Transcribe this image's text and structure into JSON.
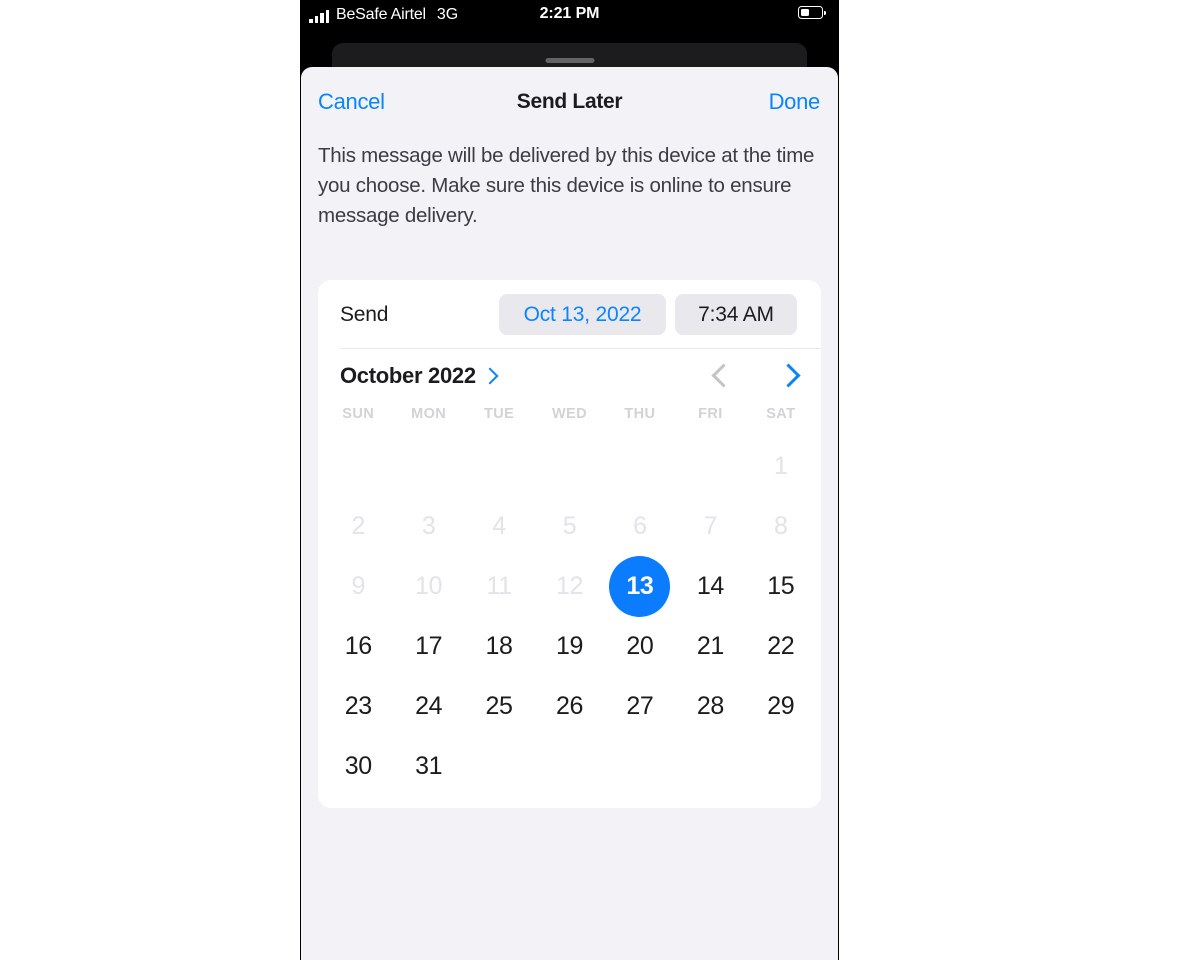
{
  "status_bar": {
    "signal_icon": "signal-bars-icon",
    "carrier": "BeSafe Airtel",
    "network": "3G",
    "time": "2:21 PM",
    "battery_icon": "battery-icon"
  },
  "navbar": {
    "cancel_label": "Cancel",
    "title": "Send Later",
    "done_label": "Done"
  },
  "description": "This message will be delivered by this device at the time you choose. Make sure this device is online to ensure message delivery.",
  "send_row": {
    "label": "Send",
    "date_value": "Oct 13, 2022",
    "time_value": "7:34 AM"
  },
  "calendar": {
    "month_title": "October 2022",
    "month_expand_icon": "chevron-right-icon",
    "prev_icon": "chevron-left-icon",
    "next_icon": "chevron-right-icon",
    "weekdays": [
      "SUN",
      "MON",
      "TUE",
      "WED",
      "THU",
      "FRI",
      "SAT"
    ],
    "selected_day": 13,
    "weeks": [
      [
        {
          "label": "",
          "state": "empty"
        },
        {
          "label": "",
          "state": "empty"
        },
        {
          "label": "",
          "state": "empty"
        },
        {
          "label": "",
          "state": "empty"
        },
        {
          "label": "",
          "state": "empty"
        },
        {
          "label": "",
          "state": "empty"
        },
        {
          "label": "1",
          "state": "disabled"
        }
      ],
      [
        {
          "label": "2",
          "state": "disabled"
        },
        {
          "label": "3",
          "state": "disabled"
        },
        {
          "label": "4",
          "state": "disabled"
        },
        {
          "label": "5",
          "state": "disabled"
        },
        {
          "label": "6",
          "state": "disabled"
        },
        {
          "label": "7",
          "state": "disabled"
        },
        {
          "label": "8",
          "state": "disabled"
        }
      ],
      [
        {
          "label": "9",
          "state": "disabled"
        },
        {
          "label": "10",
          "state": "disabled"
        },
        {
          "label": "11",
          "state": "disabled"
        },
        {
          "label": "12",
          "state": "disabled"
        },
        {
          "label": "13",
          "state": "selected"
        },
        {
          "label": "14",
          "state": "enabled"
        },
        {
          "label": "15",
          "state": "enabled"
        }
      ],
      [
        {
          "label": "16",
          "state": "enabled"
        },
        {
          "label": "17",
          "state": "enabled"
        },
        {
          "label": "18",
          "state": "enabled"
        },
        {
          "label": "19",
          "state": "enabled"
        },
        {
          "label": "20",
          "state": "enabled"
        },
        {
          "label": "21",
          "state": "enabled"
        },
        {
          "label": "22",
          "state": "enabled"
        }
      ],
      [
        {
          "label": "23",
          "state": "enabled"
        },
        {
          "label": "24",
          "state": "enabled"
        },
        {
          "label": "25",
          "state": "enabled"
        },
        {
          "label": "26",
          "state": "enabled"
        },
        {
          "label": "27",
          "state": "enabled"
        },
        {
          "label": "28",
          "state": "enabled"
        },
        {
          "label": "29",
          "state": "enabled"
        }
      ],
      [
        {
          "label": "30",
          "state": "enabled"
        },
        {
          "label": "31",
          "state": "enabled"
        },
        {
          "label": "",
          "state": "empty"
        },
        {
          "label": "",
          "state": "empty"
        },
        {
          "label": "",
          "state": "empty"
        },
        {
          "label": "",
          "state": "empty"
        },
        {
          "label": "",
          "state": "empty"
        }
      ]
    ]
  },
  "colors": {
    "accent_blue": "#0a84ff",
    "selected_blue": "#0a7cfd",
    "sheet_background": "#f2f2f7",
    "card_background": "#ffffff",
    "pill_background": "#e9e9ed",
    "disabled_day": "#e3e3e8"
  }
}
